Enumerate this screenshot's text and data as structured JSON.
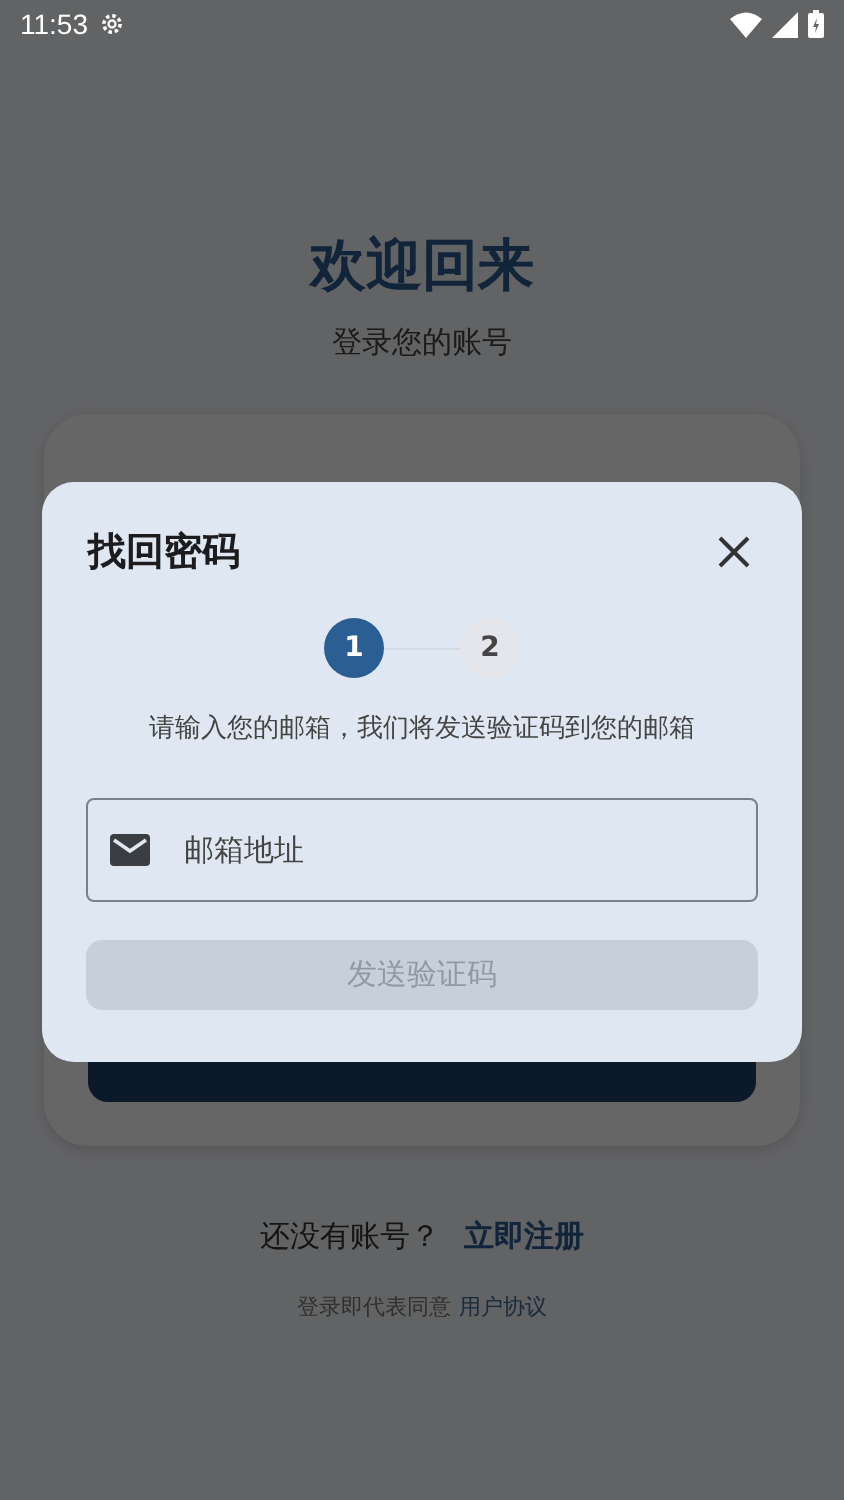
{
  "status_bar": {
    "time": "11:53"
  },
  "header": {
    "title": "欢迎回来",
    "subtitle": "登录您的账号"
  },
  "signup_prompt": {
    "text": "还没有账号？",
    "link": "立即注册"
  },
  "agreement": {
    "text": "登录即代表同意",
    "link": "用户协议"
  },
  "dialog": {
    "title": "找回密码",
    "steps": [
      {
        "label": "1",
        "selected": true
      },
      {
        "label": "2",
        "selected": false
      }
    ],
    "description": "请输入您的邮箱，我们将发送验证码到您的邮箱",
    "email_field": {
      "placeholder": "邮箱地址"
    },
    "send_button": {
      "label": "发送验证码",
      "disabled": true
    }
  }
}
